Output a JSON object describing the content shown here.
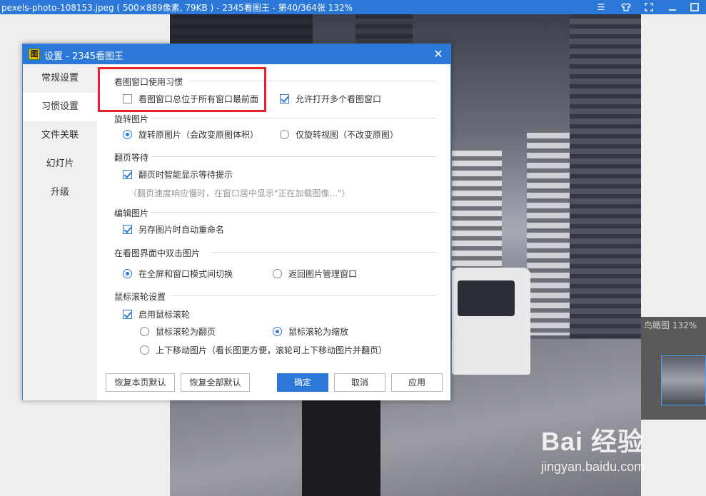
{
  "app": {
    "title": "pexels-photo-108153.jpeg ( 500×889像素, 79KB ) - 2345看图王 - 第40/364张 132%",
    "window_buttons": [
      "menu-icon",
      "skin-icon",
      "fullscreen-icon",
      "minimize-icon",
      "maximize-icon"
    ]
  },
  "thumbnail": {
    "label": "鸟瞰图 132%"
  },
  "watermark": {
    "brand": "Bai 经验",
    "site": "jingyan.baidu.com"
  },
  "dialog": {
    "title": "设置 - 2345看图王",
    "icon_char": "图",
    "close_label": "✕",
    "sidebar": [
      {
        "label": "常规设置",
        "active": false
      },
      {
        "label": "习惯设置",
        "active": true
      },
      {
        "label": "文件关联",
        "active": false
      },
      {
        "label": "幻灯片",
        "active": false
      },
      {
        "label": "升级",
        "active": false
      }
    ],
    "sections": {
      "habit": {
        "title": "看图窗口使用习惯",
        "always_on_top": {
          "label": "看图窗口总位于所有窗口最前面",
          "checked": false
        },
        "multi_window": {
          "label": "允许打开多个看图窗口",
          "checked": true
        }
      },
      "rotate": {
        "title": "旋转图片",
        "rotate_original": {
          "label": "旋转原图片（会改变原图体积）",
          "selected": true
        },
        "rotate_view": {
          "label": "仅旋转视图（不改变原图）",
          "selected": false
        }
      },
      "page_wait": {
        "title": "翻页等待",
        "smart_wait": {
          "label": "翻页时智能显示等待提示",
          "checked": true
        },
        "hint": "（翻页速度响应慢时，在窗口居中显示\"正在加载图像...\"）"
      },
      "edit": {
        "title": "编辑图片",
        "auto_rename": {
          "label": "另存图片时自动重命名",
          "checked": true
        }
      },
      "double_click": {
        "title": "在看图界面中双击图片",
        "toggle_fullscreen": {
          "label": "在全屏和窗口模式间切换",
          "selected": true
        },
        "back_to_manager": {
          "label": "返回图片管理窗口",
          "selected": false
        }
      },
      "wheel": {
        "title": "鼠标滚轮设置",
        "enable": {
          "label": "启用鼠标滚轮",
          "checked": true
        },
        "page_flip": {
          "label": "鼠标滚轮为翻页",
          "selected": false
        },
        "zoom": {
          "label": "鼠标滚轮为缩放",
          "selected": true
        },
        "move": {
          "label": "上下移动图片（看长图更方便，滚轮可上下移动图片并翻页）",
          "selected": false
        }
      }
    },
    "buttons": {
      "restore_page": "恢复本页默认",
      "restore_all": "恢复全部默认",
      "ok": "确定",
      "cancel": "取消",
      "apply": "应用"
    }
  },
  "colors": {
    "accent": "#2b78d8",
    "highlight": "#e8232b"
  }
}
